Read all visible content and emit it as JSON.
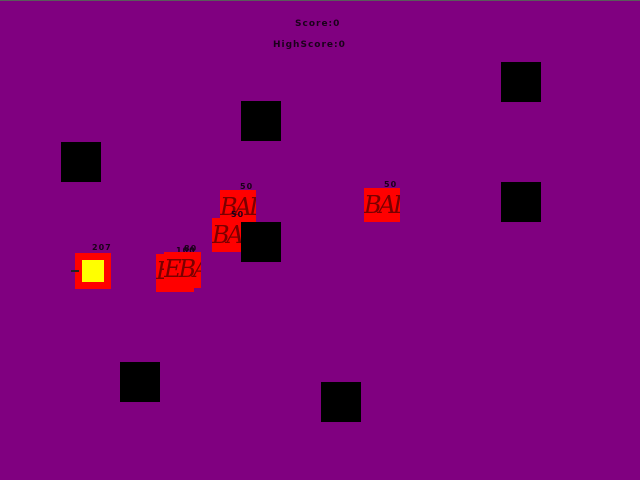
{
  "hud": {
    "score_label": "Score:",
    "score_value": "0",
    "highscore_label": "HighScore:",
    "highscore_value": "0"
  },
  "player": {
    "hp": "207",
    "body_color": "#ff0000",
    "core_color": "#ffff00"
  },
  "enemies": [
    {
      "hp": "50",
      "text": "BAD"
    },
    {
      "hp": "50",
      "text": "BAD"
    },
    {
      "hp": "50",
      "text": "BAD"
    },
    {
      "hp": "100",
      "text": "EBAD"
    },
    {
      "hp": "80",
      "text": "EBAD"
    }
  ],
  "colors": {
    "background": "#800080",
    "wall": "#000000",
    "enemy": "#ff0000"
  }
}
